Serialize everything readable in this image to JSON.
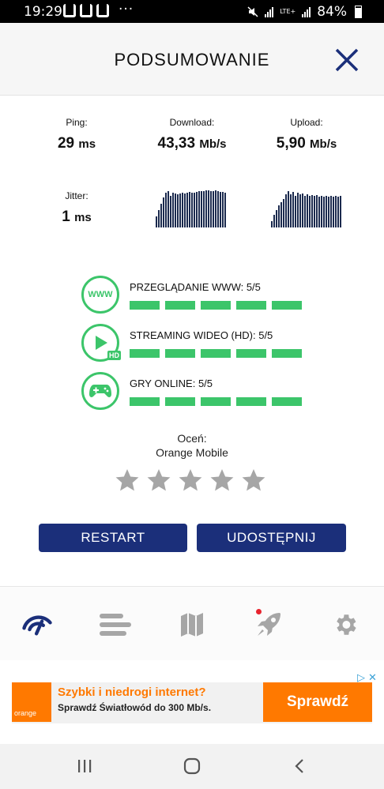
{
  "status_bar": {
    "time": "19:29",
    "dots": "···",
    "network": "LTE+",
    "battery": "84%"
  },
  "header": {
    "title": "PODSUMOWANIE"
  },
  "results": {
    "ping": {
      "label": "Ping:",
      "value": "29",
      "unit": "ms"
    },
    "download": {
      "label": "Download:",
      "value": "43,33",
      "unit": "Mb/s"
    },
    "upload": {
      "label": "Upload:",
      "value": "5,90",
      "unit": "Mb/s"
    },
    "jitter": {
      "label": "Jitter:",
      "value": "1",
      "unit": "ms"
    }
  },
  "quality": [
    {
      "icon_text": "WWW",
      "label": "PRZEGLĄDANIE WWW: 5/5",
      "score": 5,
      "max": 5
    },
    {
      "icon_badge": "HD",
      "label": "STREAMING WIDEO (HD): 5/5",
      "score": 5,
      "max": 5
    },
    {
      "label": "GRY ONLINE: 5/5",
      "score": 5,
      "max": 5
    }
  ],
  "rating": {
    "label": "Oceń:",
    "provider": "Orange Mobile",
    "stars_total": 5
  },
  "buttons": {
    "restart": "RESTART",
    "share": "UDOSTĘPNIJ"
  },
  "ad": {
    "logo_text": "orange",
    "headline": "Szybki i niedrogi internet?",
    "body": "Sprawdź Światłowód do 300 Mb/s.",
    "cta": "Sprawdź"
  },
  "colors": {
    "accent_green": "#3cc56a",
    "primary_navy": "#1b2f7a",
    "orange": "#ff7900"
  }
}
